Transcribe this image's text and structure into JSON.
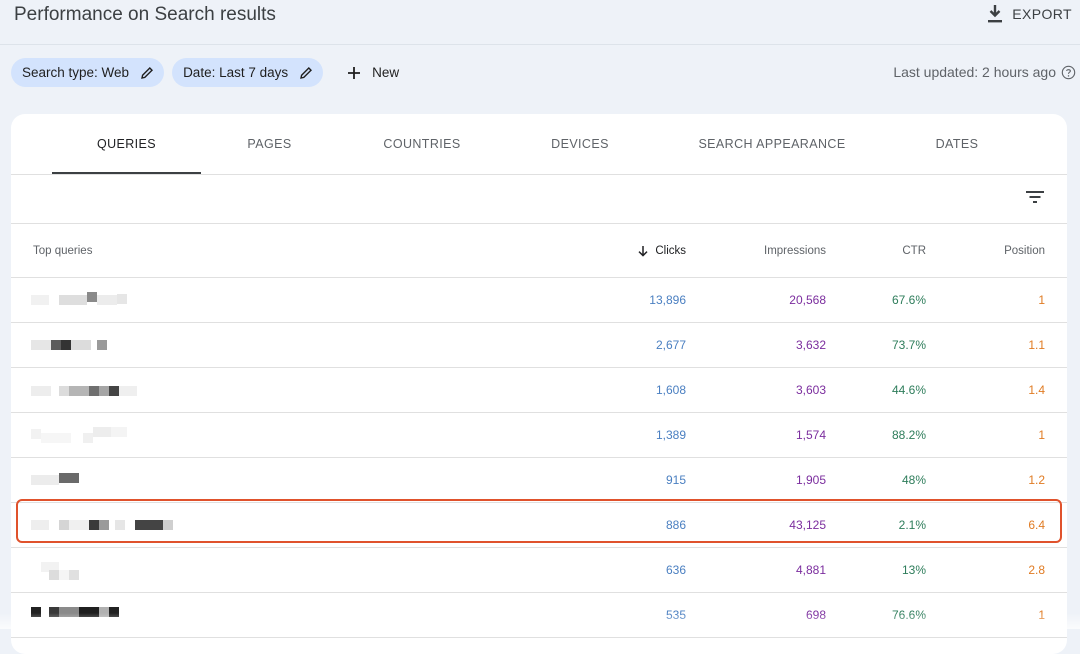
{
  "header": {
    "title": "Performance on Search results",
    "export_label": "EXPORT"
  },
  "filters": {
    "chips": [
      {
        "label": "Search type: Web"
      },
      {
        "label": "Date: Last 7 days"
      }
    ],
    "new_label": "New",
    "last_updated": "Last updated: 2 hours ago"
  },
  "tabs": [
    {
      "label": "QUERIES",
      "active": true
    },
    {
      "label": "PAGES"
    },
    {
      "label": "COUNTRIES"
    },
    {
      "label": "DEVICES"
    },
    {
      "label": "SEARCH APPEARANCE"
    },
    {
      "label": "DATES"
    }
  ],
  "table": {
    "columns": {
      "query": "Top queries",
      "clicks": "Clicks",
      "impressions": "Impressions",
      "ctr": "CTR",
      "position": "Position"
    },
    "sorted_by": "clicks",
    "rows": [
      {
        "query": "",
        "clicks": "13,896",
        "impressions": "20,568",
        "ctr": "67.6%",
        "position": "1"
      },
      {
        "query": "",
        "clicks": "2,677",
        "impressions": "3,632",
        "ctr": "73.7%",
        "position": "1.1"
      },
      {
        "query": "",
        "clicks": "1,608",
        "impressions": "3,603",
        "ctr": "44.6%",
        "position": "1.4"
      },
      {
        "query": "",
        "clicks": "1,389",
        "impressions": "1,574",
        "ctr": "88.2%",
        "position": "1"
      },
      {
        "query": "",
        "clicks": "915",
        "impressions": "1,905",
        "ctr": "48%",
        "position": "1.2"
      },
      {
        "query": "",
        "clicks": "886",
        "impressions": "43,125",
        "ctr": "2.1%",
        "position": "6.4",
        "highlighted": true
      },
      {
        "query": "",
        "clicks": "636",
        "impressions": "4,881",
        "ctr": "13%",
        "position": "2.8"
      },
      {
        "query": "",
        "clicks": "535",
        "impressions": "698",
        "ctr": "76.6%",
        "position": "1"
      }
    ]
  },
  "colors": {
    "clicks": "#4a7fc1",
    "impressions": "#7b2d9e",
    "ctr": "#2e7d5b",
    "position": "#e07b23",
    "highlight": "#e0522c",
    "chip_bg": "#d3e3fd"
  }
}
